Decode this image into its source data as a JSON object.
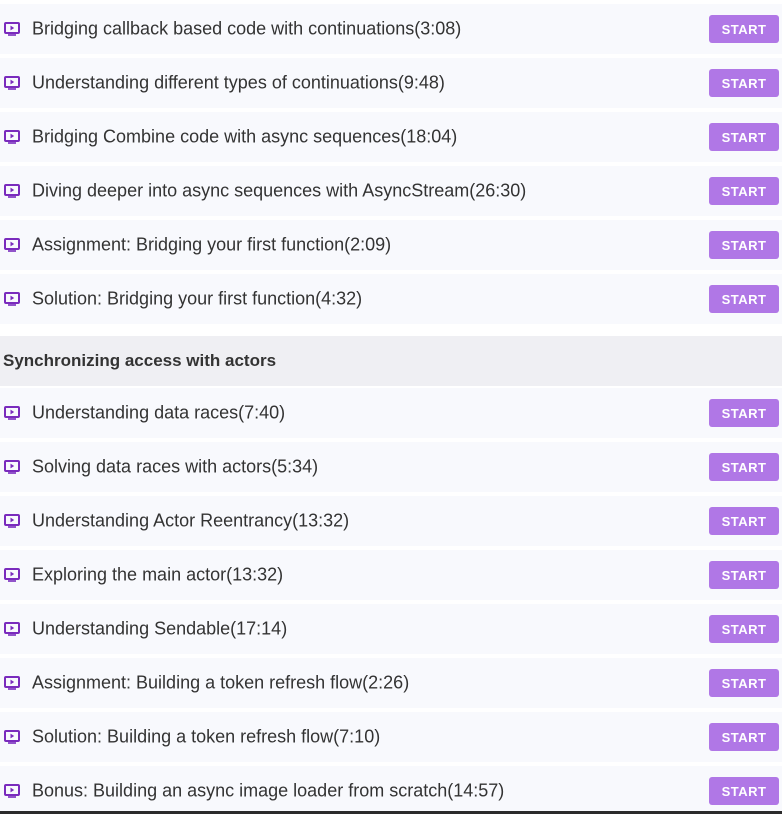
{
  "colors": {
    "accent": "#b077e6",
    "icon": "#7a2bbd",
    "row_bg": "#f8f9fd",
    "section_bg": "#efeff3",
    "text": "#333333"
  },
  "button_label": "START",
  "lecture_icon": "play-video-icon",
  "groups": [
    {
      "header": "",
      "lectures": [
        {
          "title": "Bridging callback based code with continuations(3:08)"
        },
        {
          "title": "Understanding different types of continuations(9:48)"
        },
        {
          "title": "Bridging Combine code with async sequences(18:04)"
        },
        {
          "title": "Diving deeper into async sequences with AsyncStream(26:30)"
        },
        {
          "title": "Assignment: Bridging your first function(2:09)"
        },
        {
          "title": "Solution: Bridging your first function(4:32)"
        }
      ]
    },
    {
      "header": "Synchronizing access with actors",
      "lectures": [
        {
          "title": "Understanding data races(7:40)"
        },
        {
          "title": "Solving data races with actors(5:34)"
        },
        {
          "title": "Understanding Actor Reentrancy(13:32)"
        },
        {
          "title": "Exploring the main actor(13:32)"
        },
        {
          "title": "Understanding Sendable(17:14)"
        },
        {
          "title": "Assignment: Building a token refresh flow(2:26)"
        },
        {
          "title": "Solution: Building a token refresh flow(7:10)"
        },
        {
          "title": "Bonus: Building an async image loader from scratch(14:57)"
        }
      ]
    }
  ]
}
